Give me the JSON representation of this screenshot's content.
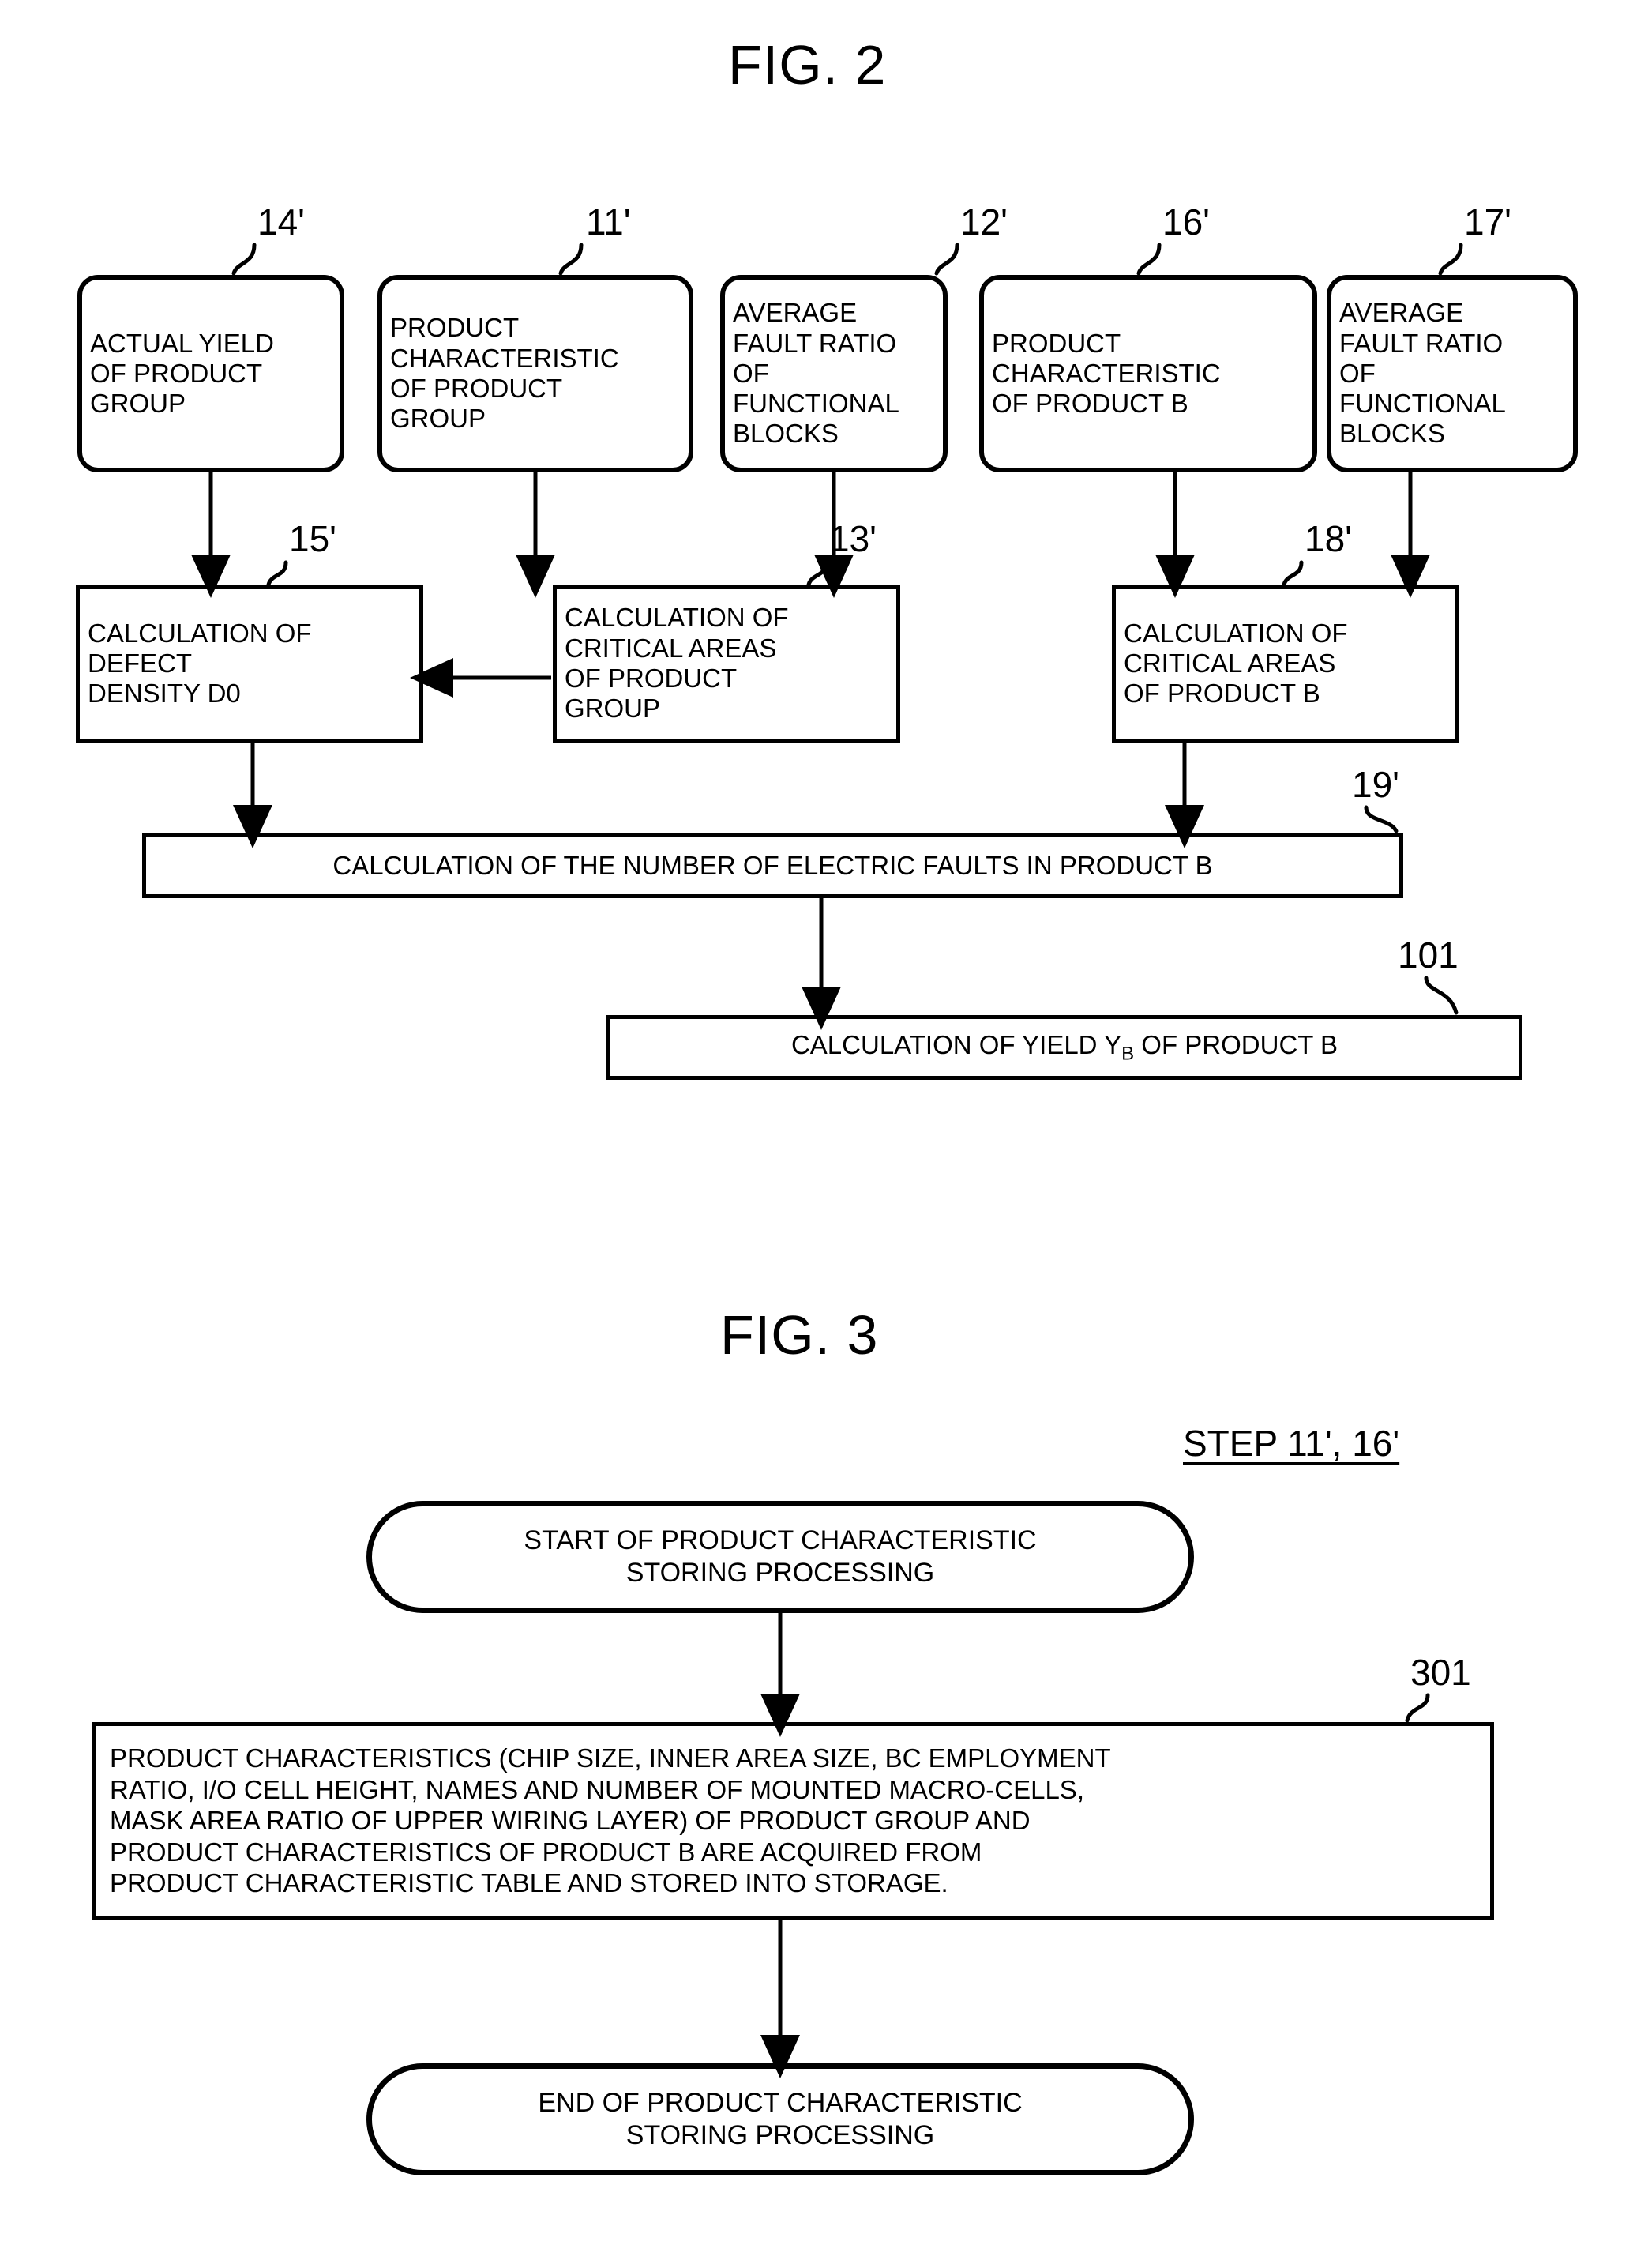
{
  "figures": [
    {
      "id": "fig2",
      "title": "FIG. 2",
      "nodes": [
        {
          "ref": "14'",
          "label": "ACTUAL YIELD OF PRODUCT GROUP",
          "lines": [
            "ACTUAL YIELD",
            "OF PRODUCT",
            "GROUP"
          ],
          "shape": "rounded"
        },
        {
          "ref": "11'",
          "label": "PRODUCT CHARACTERISTIC OF PRODUCT GROUP",
          "lines": [
            "PRODUCT",
            "CHARACTERISTIC",
            "OF PRODUCT",
            "GROUP"
          ],
          "shape": "rounded"
        },
        {
          "ref": "12'",
          "label": "AVERAGE FAULT RATIO OF FUNCTIONAL BLOCKS",
          "lines": [
            "AVERAGE",
            "FAULT RATIO",
            "OF",
            "FUNCTIONAL",
            "BLOCKS"
          ],
          "shape": "rounded"
        },
        {
          "ref": "16'",
          "label": "PRODUCT CHARACTERISTIC OF PRODUCT B",
          "lines": [
            "PRODUCT",
            "CHARACTERISTIC",
            "OF PRODUCT B"
          ],
          "shape": "rounded"
        },
        {
          "ref": "17'",
          "label": "AVERAGE FAULT RATIO OF FUNCTIONAL BLOCKS",
          "lines": [
            "AVERAGE",
            "FAULT RATIO",
            "OF",
            "FUNCTIONAL",
            "BLOCKS"
          ],
          "shape": "rounded"
        },
        {
          "ref": "15'",
          "label": "CALCULATION OF DEFECT DENSITY D0",
          "lines": [
            "CALCULATION OF",
            "DEFECT",
            "DENSITY D0"
          ],
          "shape": "rect"
        },
        {
          "ref": "13'",
          "label": "CALCULATION OF CRITICAL AREAS OF PRODUCT GROUP",
          "lines": [
            "CALCULATION OF",
            "CRITICAL AREAS",
            "OF PRODUCT",
            "GROUP"
          ],
          "shape": "rect"
        },
        {
          "ref": "18'",
          "label": "CALCULATION OF CRITICAL AREAS OF PRODUCT B",
          "lines": [
            "CALCULATION OF",
            "CRITICAL AREAS",
            "OF PRODUCT B"
          ],
          "shape": "rect"
        },
        {
          "ref": "19'",
          "label": "CALCULATION OF THE NUMBER OF ELECTRIC FAULTS IN PRODUCT B",
          "lines": [
            "CALCULATION OF THE NUMBER OF ELECTRIC FAULTS IN PRODUCT B"
          ],
          "shape": "rect"
        },
        {
          "ref": "101",
          "label": "CALCULATION OF YIELD YB OF PRODUCT B",
          "lines": [
            "CALCULATION OF YIELD Y",
            "B",
            " OF PRODUCT B"
          ],
          "shape": "rect"
        }
      ]
    },
    {
      "id": "fig3",
      "title": "FIG. 3",
      "step_label": "STEP 11', 16'",
      "nodes": [
        {
          "ref": "",
          "label": "START OF PRODUCT CHARACTERISTIC STORING PROCESSING",
          "lines": [
            "START OF PRODUCT CHARACTERISTIC",
            "STORING PROCESSING"
          ],
          "shape": "terminator"
        },
        {
          "ref": "301",
          "label": "PRODUCT CHARACTERISTICS (CHIP SIZE, INNER AREA SIZE, BC EMPLOYMENT RATIO, I/O CELL HEIGHT, NAMES AND NUMBER OF MOUNTED MACRO-CELLS, MASK AREA RATIO OF UPPER WIRING LAYER) OF PRODUCT GROUP AND PRODUCT CHARACTERISTICS OF PRODUCT B ARE ACQUIRED FROM PRODUCT CHARACTERISTIC TABLE AND STORED INTO STORAGE.",
          "lines": [
            "PRODUCT CHARACTERISTICS (CHIP SIZE, INNER AREA SIZE, BC EMPLOYMENT",
            "RATIO, I/O CELL HEIGHT, NAMES AND NUMBER OF MOUNTED MACRO-CELLS,",
            "MASK AREA RATIO OF UPPER WIRING LAYER) OF PRODUCT GROUP AND",
            "PRODUCT CHARACTERISTICS OF PRODUCT B ARE ACQUIRED FROM",
            "PRODUCT CHARACTERISTIC TABLE AND STORED INTO STORAGE."
          ],
          "shape": "rect"
        },
        {
          "ref": "",
          "label": "END OF PRODUCT CHARACTERISTIC STORING PROCESSING",
          "lines": [
            "END OF PRODUCT CHARACTERISTIC",
            "STORING PROCESSING"
          ],
          "shape": "terminator"
        }
      ]
    }
  ],
  "fig2": {
    "title": "FIG. 2",
    "n14_l1": "ACTUAL YIELD",
    "n14_l2": "OF PRODUCT",
    "n14_l3": "GROUP",
    "r14": "14'",
    "n11_l1": "PRODUCT",
    "n11_l2": "CHARACTERISTIC",
    "n11_l3": "OF PRODUCT",
    "n11_l4": "GROUP",
    "r11": "11'",
    "n12_l1": "AVERAGE",
    "n12_l2": "FAULT RATIO",
    "n12_l3": "OF",
    "n12_l4": "FUNCTIONAL",
    "n12_l5": "BLOCKS",
    "r12": "12'",
    "n16_l1": "PRODUCT",
    "n16_l2": "CHARACTERISTIC",
    "n16_l3": "OF PRODUCT B",
    "r16": "16'",
    "n17_l1": "AVERAGE",
    "n17_l2": "FAULT RATIO",
    "n17_l3": "OF",
    "n17_l4": "FUNCTIONAL",
    "n17_l5": "BLOCKS",
    "r17": "17'",
    "n15_l1": "CALCULATION OF",
    "n15_l2": "DEFECT",
    "n15_l3": "DENSITY D0",
    "r15": "15'",
    "n13_l1": "CALCULATION OF",
    "n13_l2": "CRITICAL AREAS",
    "n13_l3": "OF PRODUCT",
    "n13_l4": "GROUP",
    "r13": "13'",
    "n18_l1": "CALCULATION OF",
    "n18_l2": "CRITICAL AREAS",
    "n18_l3": "OF PRODUCT B",
    "r18": "18'",
    "n19_l1": "CALCULATION OF THE NUMBER OF ELECTRIC FAULTS IN PRODUCT B",
    "r19": "19'",
    "n101_a": "CALCULATION OF YIELD Y",
    "n101_sub": "B",
    "n101_b": " OF PRODUCT B",
    "r101": "101"
  },
  "fig3": {
    "title": "FIG. 3",
    "step_label": "STEP 11', 16'",
    "start_l1": "START OF PRODUCT CHARACTERISTIC",
    "start_l2": "STORING PROCESSING",
    "p301_l1": "PRODUCT CHARACTERISTICS (CHIP SIZE, INNER AREA SIZE, BC EMPLOYMENT",
    "p301_l2": "RATIO, I/O CELL HEIGHT, NAMES AND NUMBER OF MOUNTED MACRO-CELLS,",
    "p301_l3": "MASK AREA RATIO OF UPPER WIRING LAYER) OF PRODUCT GROUP AND",
    "p301_l4": "PRODUCT CHARACTERISTICS OF PRODUCT B ARE ACQUIRED FROM",
    "p301_l5": "PRODUCT CHARACTERISTIC TABLE AND STORED INTO STORAGE.",
    "r301": "301",
    "end_l1": "END OF PRODUCT CHARACTERISTIC",
    "end_l2": "STORING PROCESSING"
  },
  "colors": {
    "ink": "#000000",
    "paper": "#ffffff"
  }
}
